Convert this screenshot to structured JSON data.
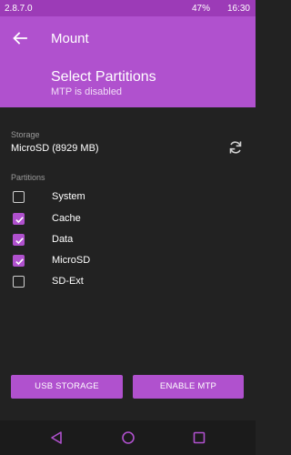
{
  "status": {
    "version": "2.8.7.0",
    "battery": "47%",
    "time": "16:30"
  },
  "appbar": {
    "title": "Mount"
  },
  "header": {
    "title": "Select Partitions",
    "subtitle": "MTP is disabled"
  },
  "storage": {
    "label": "Storage",
    "value": "MicroSD (8929 MB)"
  },
  "partitions": {
    "label": "Partitions",
    "items": [
      {
        "label": "System",
        "checked": false
      },
      {
        "label": "Cache",
        "checked": true
      },
      {
        "label": "Data",
        "checked": true
      },
      {
        "label": "MicroSD",
        "checked": true
      },
      {
        "label": "SD-Ext",
        "checked": false
      }
    ]
  },
  "buttons": {
    "usb_storage": "USB STORAGE",
    "enable_mtp": "ENABLE MTP"
  },
  "colors": {
    "accent": "#b051ce",
    "status_bar": "#9c3bb7",
    "background": "#222222"
  },
  "icons": {
    "back": "arrow-back-icon",
    "refresh": "refresh-icon",
    "nav_back": "triangle-back-icon",
    "nav_home": "circle-home-icon",
    "nav_recent": "square-recent-icon"
  }
}
